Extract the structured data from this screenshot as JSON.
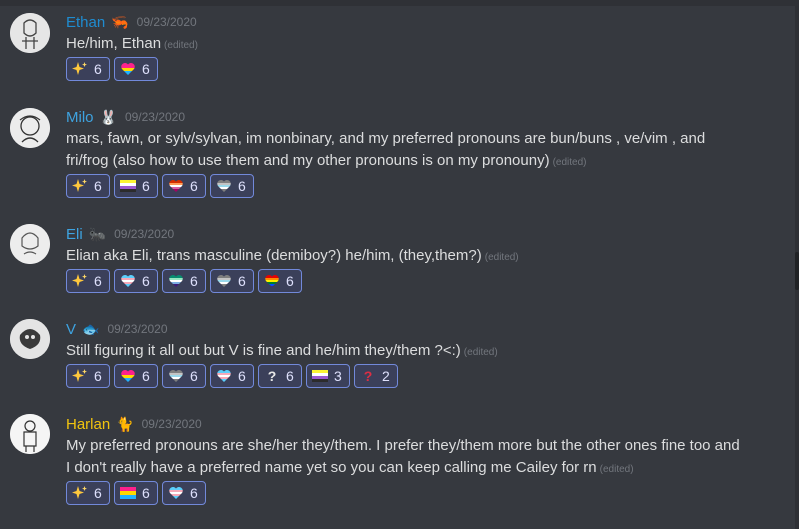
{
  "messages": [
    {
      "username": "Ethan",
      "name_color": "#1f8cd0",
      "badge": "🦐",
      "timestamp": "09/23/2020",
      "text": "He/him, Ethan",
      "edited": "(edited)",
      "reactions": [
        {
          "emoji": "sparkles-icon",
          "count": "6"
        },
        {
          "emoji": "pansexual-heart-icon",
          "count": "6"
        }
      ]
    },
    {
      "username": "Milo",
      "name_color": "#3ea3e0",
      "badge": "🐰",
      "timestamp": "09/23/2020",
      "text": "mars, fawn, or sylv/sylvan, im nonbinary, and my preferred pronouns are bun/buns , ve/vim , and fri/frog (also how to use them and my other pronouns is on my pronouny)",
      "edited": "(edited)",
      "reactions": [
        {
          "emoji": "sparkles-icon",
          "count": "6"
        },
        {
          "emoji": "nonbinary-flag-icon",
          "count": "6"
        },
        {
          "emoji": "lesbian-heart-icon",
          "count": "6"
        },
        {
          "emoji": "demiboy-heart-icon",
          "count": "6"
        }
      ]
    },
    {
      "username": "Eli",
      "name_color": "#3ea3e0",
      "badge": "🐜",
      "timestamp": "09/23/2020",
      "text": "Elian aka Eli, trans masculine (demiboy?) he/him, (they,them?)",
      "edited": "(edited)",
      "reactions": [
        {
          "emoji": "sparkles-icon",
          "count": "6"
        },
        {
          "emoji": "trans-heart-icon",
          "count": "6"
        },
        {
          "emoji": "gay-men-heart-icon",
          "count": "6"
        },
        {
          "emoji": "demiboy-heart-icon",
          "count": "6"
        },
        {
          "emoji": "pride-heart-icon",
          "count": "6"
        }
      ]
    },
    {
      "username": "V",
      "name_color": "#3ea3e0",
      "badge": "🐟",
      "timestamp": "09/23/2020",
      "text": "Still figuring it all out but V is fine and he/him they/them ?<:)",
      "edited": "(edited)",
      "reactions": [
        {
          "emoji": "sparkles-icon",
          "count": "6"
        },
        {
          "emoji": "pansexual-heart-icon",
          "count": "6"
        },
        {
          "emoji": "demiboy-heart-icon",
          "count": "6"
        },
        {
          "emoji": "trans-heart-icon",
          "count": "6"
        },
        {
          "emoji": "white-question-icon",
          "count": "6"
        },
        {
          "emoji": "nonbinary-flag-icon",
          "count": "3"
        },
        {
          "emoji": "red-question-icon",
          "count": "2"
        }
      ]
    },
    {
      "username": "Harlan",
      "name_color": "#f1c40f",
      "badge": "🐈",
      "timestamp": "09/23/2020",
      "text": "My preferred pronouns are she/her they/them. I prefer they/them more but the other ones fine too and I don't really have a preferred name yet so you can keep calling me Cailey for rn",
      "edited": "(edited)",
      "reactions": [
        {
          "emoji": "sparkles-icon",
          "count": "6"
        },
        {
          "emoji": "pansexual-flag-icon",
          "count": "6"
        },
        {
          "emoji": "trans-heart-icon",
          "count": "6"
        }
      ]
    }
  ],
  "colors": {
    "background": "#36393f",
    "reaction_border": "#7289da",
    "reaction_bg": "#3b405a",
    "timestamp": "#72767d"
  }
}
